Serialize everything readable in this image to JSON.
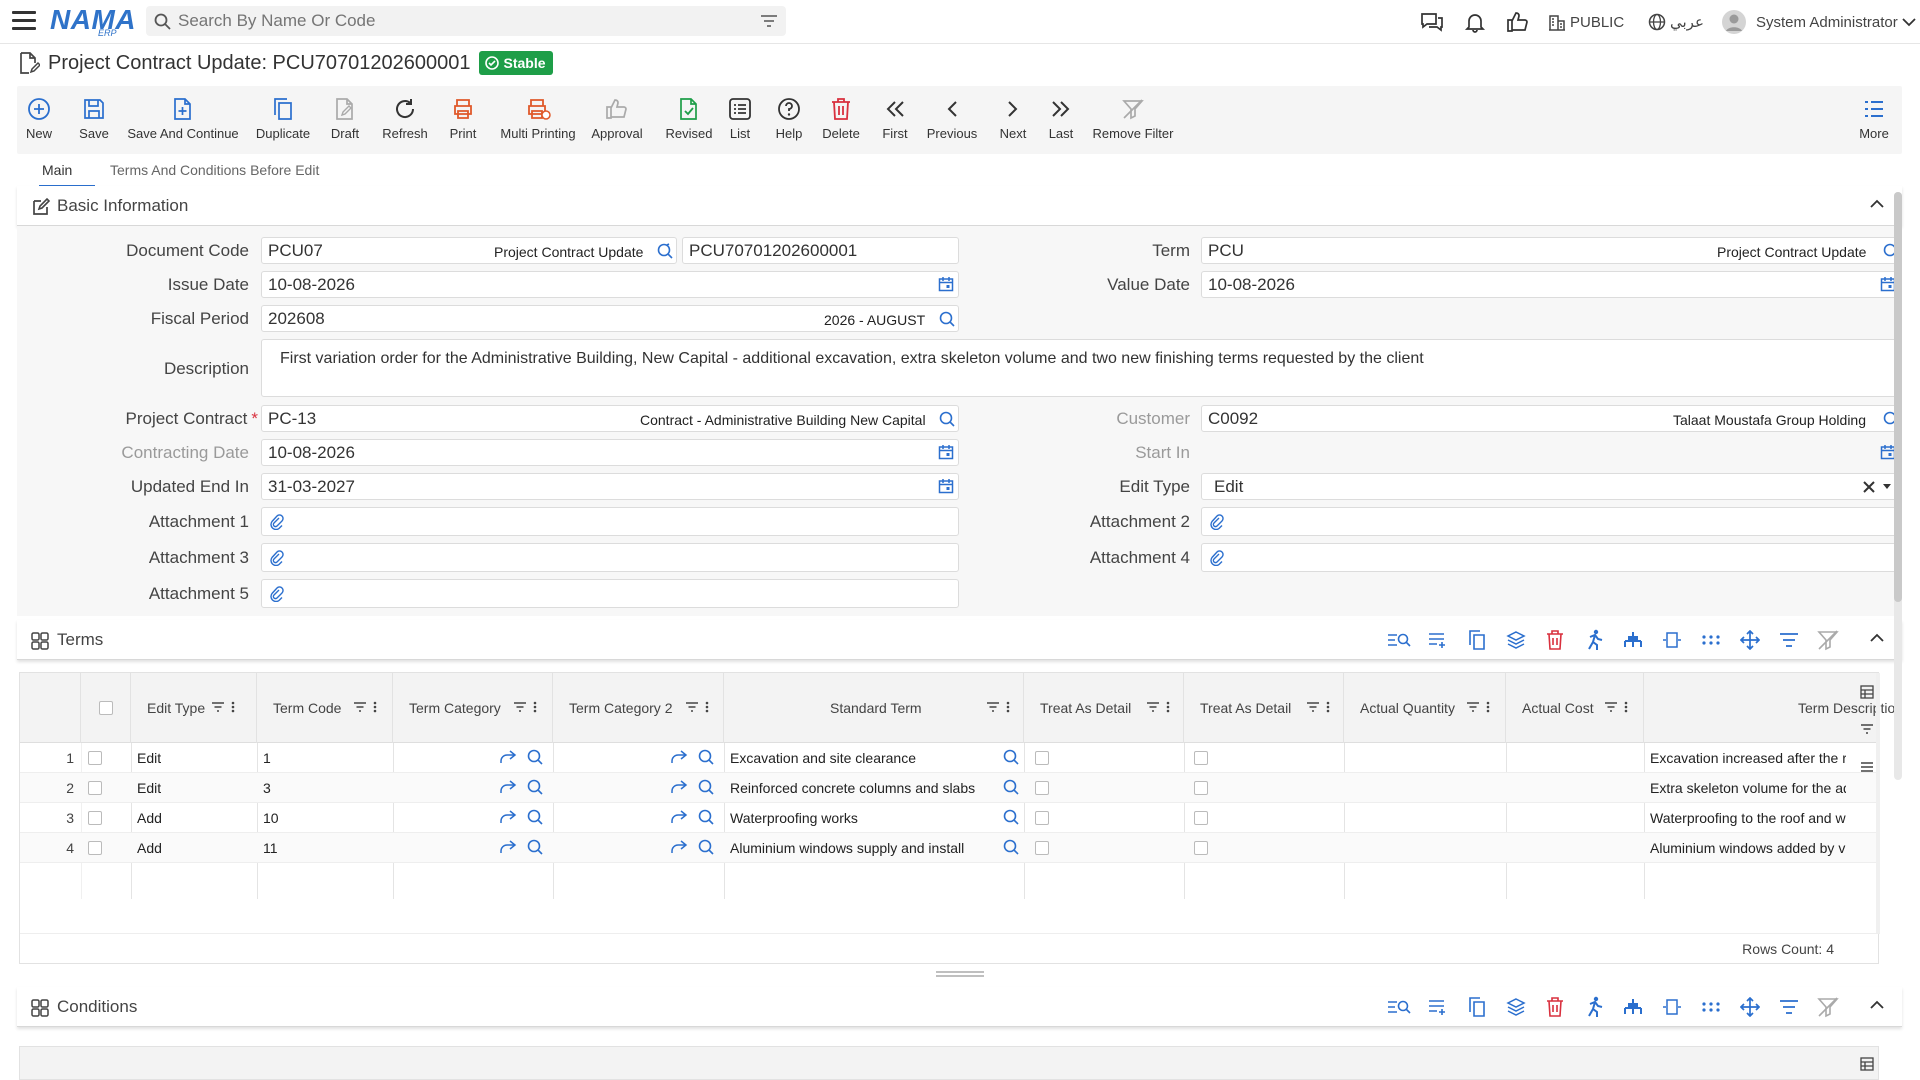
{
  "topbar": {
    "search_placeholder": "Search By Name Or Code",
    "branch": "PUBLIC",
    "language": "عربي",
    "user": "System Administrator",
    "logo_text": "NAMA",
    "logo_sub": "ERP"
  },
  "page": {
    "title": "Project Contract Update: PCU70701202600001",
    "status": "Stable"
  },
  "toolbar": [
    "New",
    "Save",
    "Save And Continue",
    "Duplicate",
    "Draft",
    "Refresh",
    "Print",
    "Multi Printing",
    "Approval",
    "Revised",
    "List",
    "Help",
    "Delete",
    "First",
    "Previous",
    "Next",
    "Last",
    "Remove Filter",
    "More"
  ],
  "tabs": [
    "Main",
    "Terms And Conditions Before Edit"
  ],
  "sections": {
    "basic": "Basic Information",
    "terms": "Terms",
    "conditions": "Conditions"
  },
  "form": {
    "document_code": {
      "label": "Document Code",
      "value": "PCU07",
      "hint": "Project Contract Update",
      "number": "PCU70701202600001"
    },
    "term": {
      "label": "Term",
      "value": "PCU",
      "hint": "Project Contract Update"
    },
    "issue_date": {
      "label": "Issue Date",
      "value": "10-08-2026"
    },
    "value_date": {
      "label": "Value Date",
      "value": "10-08-2026"
    },
    "fiscal_period": {
      "label": "Fiscal Period",
      "value": "202608",
      "hint": "2026 - AUGUST"
    },
    "description": {
      "label": "Description",
      "value": "First variation order for the Administrative Building, New Capital - additional excavation, extra skeleton volume and two new finishing terms requested by the client"
    },
    "project_contract": {
      "label": "Project Contract",
      "required": "*",
      "value": "PC-13",
      "hint": "Contract - Administrative Building New Capital"
    },
    "customer": {
      "label": "Customer",
      "value": "C0092",
      "hint": "Talaat Moustafa Group Holding"
    },
    "contracting_date": {
      "label": "Contracting Date",
      "value": "10-08-2026"
    },
    "start_in": {
      "label": "Start In",
      "value": ""
    },
    "updated_end_in": {
      "label": "Updated End In",
      "value": "31-03-2027"
    },
    "edit_type": {
      "label": "Edit Type",
      "value": "Edit"
    },
    "attachment_1": {
      "label": "Attachment 1"
    },
    "attachment_2": {
      "label": "Attachment 2"
    },
    "attachment_3": {
      "label": "Attachment 3"
    },
    "attachment_4": {
      "label": "Attachment 4"
    },
    "attachment_5": {
      "label": "Attachment 5"
    }
  },
  "terms_grid": {
    "columns": [
      "Edit Type",
      "Term Code",
      "Term Category",
      "Term Category 2",
      "Standard Term",
      "Treat As Detail",
      "Treat As Detail",
      "Actual Quantity",
      "Actual Cost",
      "Term Descriptio"
    ],
    "rows": [
      {
        "n": "1",
        "edit_type": "Edit",
        "term_code": "1",
        "standard_term": "Excavation and site clearance",
        "description": "Excavation increased after the revis"
      },
      {
        "n": "2",
        "edit_type": "Edit",
        "term_code": "3",
        "standard_term": "Reinforced concrete columns and slabs",
        "description": "Extra skeleton volume for the added"
      },
      {
        "n": "3",
        "edit_type": "Add",
        "term_code": "10",
        "standard_term": "Waterproofing works",
        "description": "Waterproofing to the roof and wet ar"
      },
      {
        "n": "4",
        "edit_type": "Add",
        "term_code": "11",
        "standard_term": "Aluminium windows supply and install",
        "description": "Aluminium windows added by variat"
      }
    ],
    "rows_count": "Rows Count: 4"
  }
}
